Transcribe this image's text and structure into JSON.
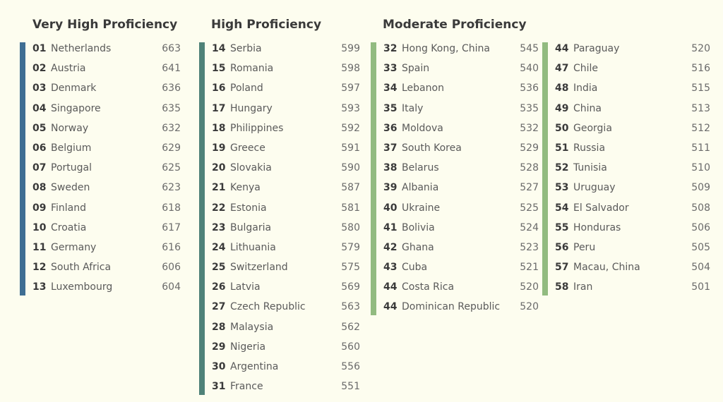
{
  "chart_data": {
    "type": "table",
    "title": "",
    "groups": [
      {
        "name": "Very High Proficiency",
        "color": "#3f6e93",
        "rows": [
          {
            "rank": "01",
            "country": "Netherlands",
            "score": 663
          },
          {
            "rank": "02",
            "country": "Austria",
            "score": 641
          },
          {
            "rank": "03",
            "country": "Denmark",
            "score": 636
          },
          {
            "rank": "04",
            "country": "Singapore",
            "score": 635
          },
          {
            "rank": "05",
            "country": "Norway",
            "score": 632
          },
          {
            "rank": "06",
            "country": "Belgium",
            "score": 629
          },
          {
            "rank": "07",
            "country": "Portugal",
            "score": 625
          },
          {
            "rank": "08",
            "country": "Sweden",
            "score": 623
          },
          {
            "rank": "09",
            "country": "Finland",
            "score": 618
          },
          {
            "rank": "10",
            "country": "Croatia",
            "score": 617
          },
          {
            "rank": "11",
            "country": "Germany",
            "score": 616
          },
          {
            "rank": "12",
            "country": "South Africa",
            "score": 606
          },
          {
            "rank": "13",
            "country": "Luxembourg",
            "score": 604
          }
        ]
      },
      {
        "name": "High Proficiency",
        "color": "#4f8278",
        "rows": [
          {
            "rank": "14",
            "country": "Serbia",
            "score": 599
          },
          {
            "rank": "15",
            "country": "Romania",
            "score": 598
          },
          {
            "rank": "16",
            "country": "Poland",
            "score": 597
          },
          {
            "rank": "17",
            "country": "Hungary",
            "score": 593
          },
          {
            "rank": "18",
            "country": "Philippines",
            "score": 592
          },
          {
            "rank": "19",
            "country": "Greece",
            "score": 591
          },
          {
            "rank": "20",
            "country": "Slovakia",
            "score": 590
          },
          {
            "rank": "21",
            "country": "Kenya",
            "score": 587
          },
          {
            "rank": "22",
            "country": "Estonia",
            "score": 581
          },
          {
            "rank": "23",
            "country": "Bulgaria",
            "score": 580
          },
          {
            "rank": "24",
            "country": "Lithuania",
            "score": 579
          },
          {
            "rank": "25",
            "country": "Switzerland",
            "score": 575
          },
          {
            "rank": "26",
            "country": "Latvia",
            "score": 569
          },
          {
            "rank": "27",
            "country": "Czech Republic",
            "score": 563
          },
          {
            "rank": "28",
            "country": "Malaysia",
            "score": 562
          },
          {
            "rank": "29",
            "country": "Nigeria",
            "score": 560
          },
          {
            "rank": "30",
            "country": "Argentina",
            "score": 556
          },
          {
            "rank": "31",
            "country": "France",
            "score": 551
          }
        ]
      },
      {
        "name": "Moderate Proficiency",
        "color": "#92bb80",
        "rows": [
          {
            "rank": "32",
            "country": "Hong Kong, China",
            "score": 545
          },
          {
            "rank": "33",
            "country": "Spain",
            "score": 540
          },
          {
            "rank": "34",
            "country": "Lebanon",
            "score": 536
          },
          {
            "rank": "35",
            "country": "Italy",
            "score": 535
          },
          {
            "rank": "36",
            "country": "Moldova",
            "score": 532
          },
          {
            "rank": "37",
            "country": "South Korea",
            "score": 529
          },
          {
            "rank": "38",
            "country": "Belarus",
            "score": 528
          },
          {
            "rank": "39",
            "country": "Albania",
            "score": 527
          },
          {
            "rank": "40",
            "country": "Ukraine",
            "score": 525
          },
          {
            "rank": "41",
            "country": "Bolivia",
            "score": 524
          },
          {
            "rank": "42",
            "country": "Ghana",
            "score": 523
          },
          {
            "rank": "43",
            "country": "Cuba",
            "score": 521
          },
          {
            "rank": "44",
            "country": "Costa Rica",
            "score": 520
          },
          {
            "rank": "44",
            "country": "Dominican Republic",
            "score": 520
          }
        ]
      },
      {
        "name": "",
        "color": "#92bb80",
        "rows": [
          {
            "rank": "44",
            "country": "Paraguay",
            "score": 520
          },
          {
            "rank": "47",
            "country": "Chile",
            "score": 516
          },
          {
            "rank": "48",
            "country": "India",
            "score": 515
          },
          {
            "rank": "49",
            "country": "China",
            "score": 513
          },
          {
            "rank": "50",
            "country": "Georgia",
            "score": 512
          },
          {
            "rank": "51",
            "country": "Russia",
            "score": 511
          },
          {
            "rank": "52",
            "country": "Tunisia",
            "score": 510
          },
          {
            "rank": "53",
            "country": "Uruguay",
            "score": 509
          },
          {
            "rank": "54",
            "country": "El Salvador",
            "score": 508
          },
          {
            "rank": "55",
            "country": "Honduras",
            "score": 506
          },
          {
            "rank": "56",
            "country": "Peru",
            "score": 505
          },
          {
            "rank": "57",
            "country": "Macau, China",
            "score": 504
          },
          {
            "rank": "58",
            "country": "Iran",
            "score": 501
          }
        ]
      }
    ]
  }
}
